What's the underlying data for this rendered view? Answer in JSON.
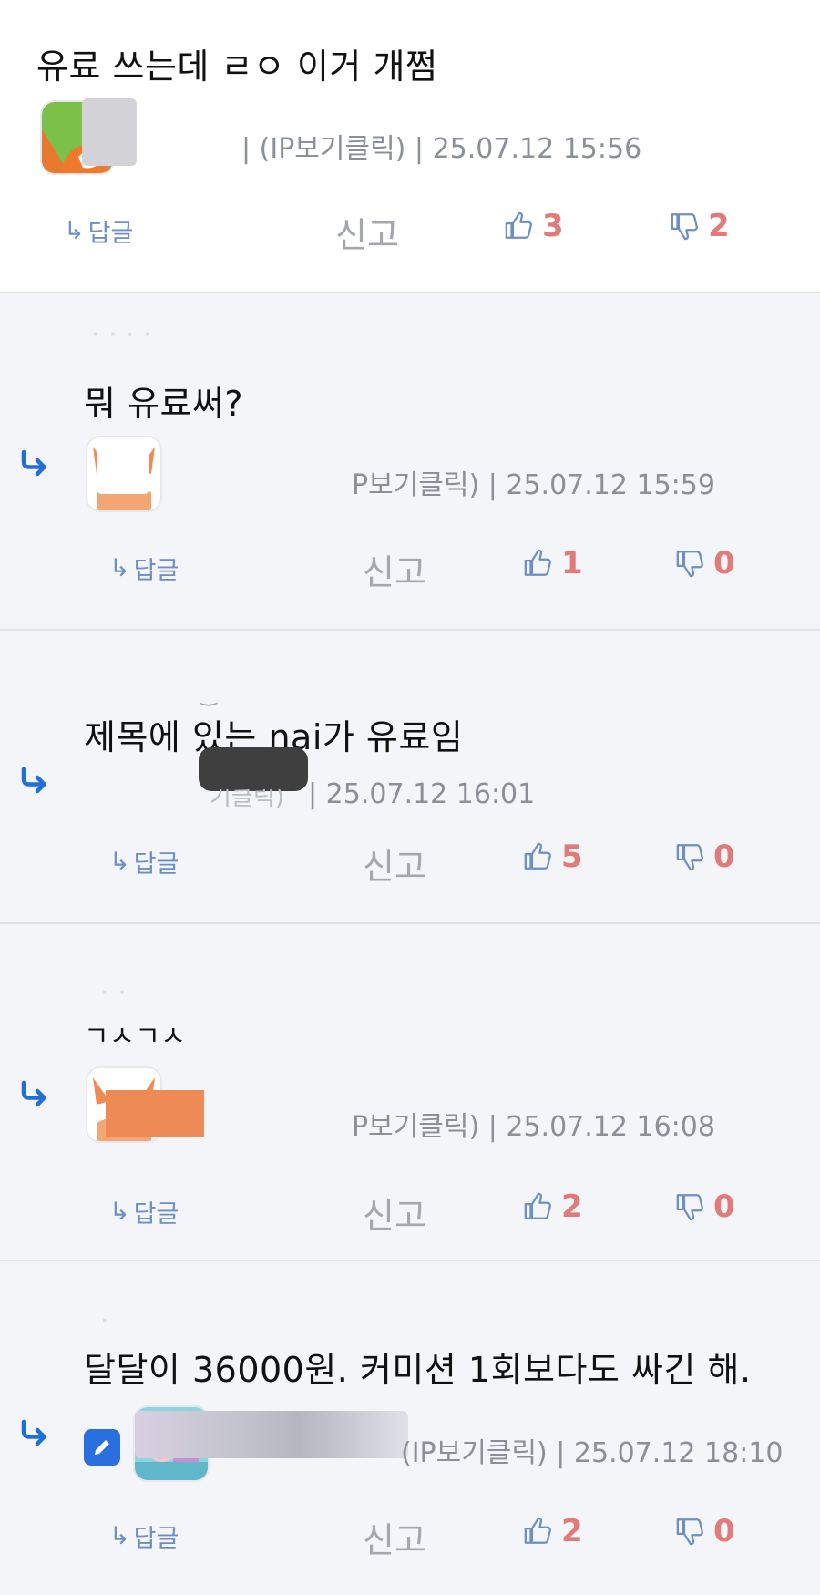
{
  "comments": [
    {
      "text": "유료 쓰는데 ㄹㅇ 이거 개쩜",
      "meta": "| (IP보기클릭) | 25.07.12 15:56",
      "reply_label": "답글",
      "report_label": "신고",
      "likes": "3",
      "dislikes": "2",
      "avatar": "fox-icon"
    },
    {
      "text": "뭐 유료써?",
      "meta": "P보기클릭) | 25.07.12 15:59",
      "reply_label": "답글",
      "report_label": "신고",
      "likes": "1",
      "dislikes": "0",
      "avatar": "fox-icon"
    },
    {
      "text": "제목에 있는 nai가 유료임",
      "meta": "| 25.07.12 16:01",
      "meta_prefix": "기클릭)",
      "reply_label": "답글",
      "report_label": "신고",
      "likes": "5",
      "dislikes": "0"
    },
    {
      "text": "ㄱㅅㄱㅅ",
      "meta": "P보기클릭) | 25.07.12 16:08",
      "reply_label": "답글",
      "report_label": "신고",
      "likes": "2",
      "dislikes": "0",
      "avatar": "fox-icon"
    },
    {
      "text": "달달이 36000원. 커미션 1회보다도 싸긴 해.",
      "meta": "(IP보기클릭) | 25.07.12 18:10",
      "reply_label": "답글",
      "report_label": "신고",
      "likes": "2",
      "dislikes": "0",
      "avatar": "anime-avatar-icon",
      "edit_badge": "pencil-icon"
    }
  ],
  "colors": {
    "reply_arrow": "#1f6fd6",
    "action_blue": "#6d8fc2",
    "vote_red": "#e27a7a",
    "muted": "#a4a8ae",
    "reply_bg": "#f3f5f8"
  }
}
